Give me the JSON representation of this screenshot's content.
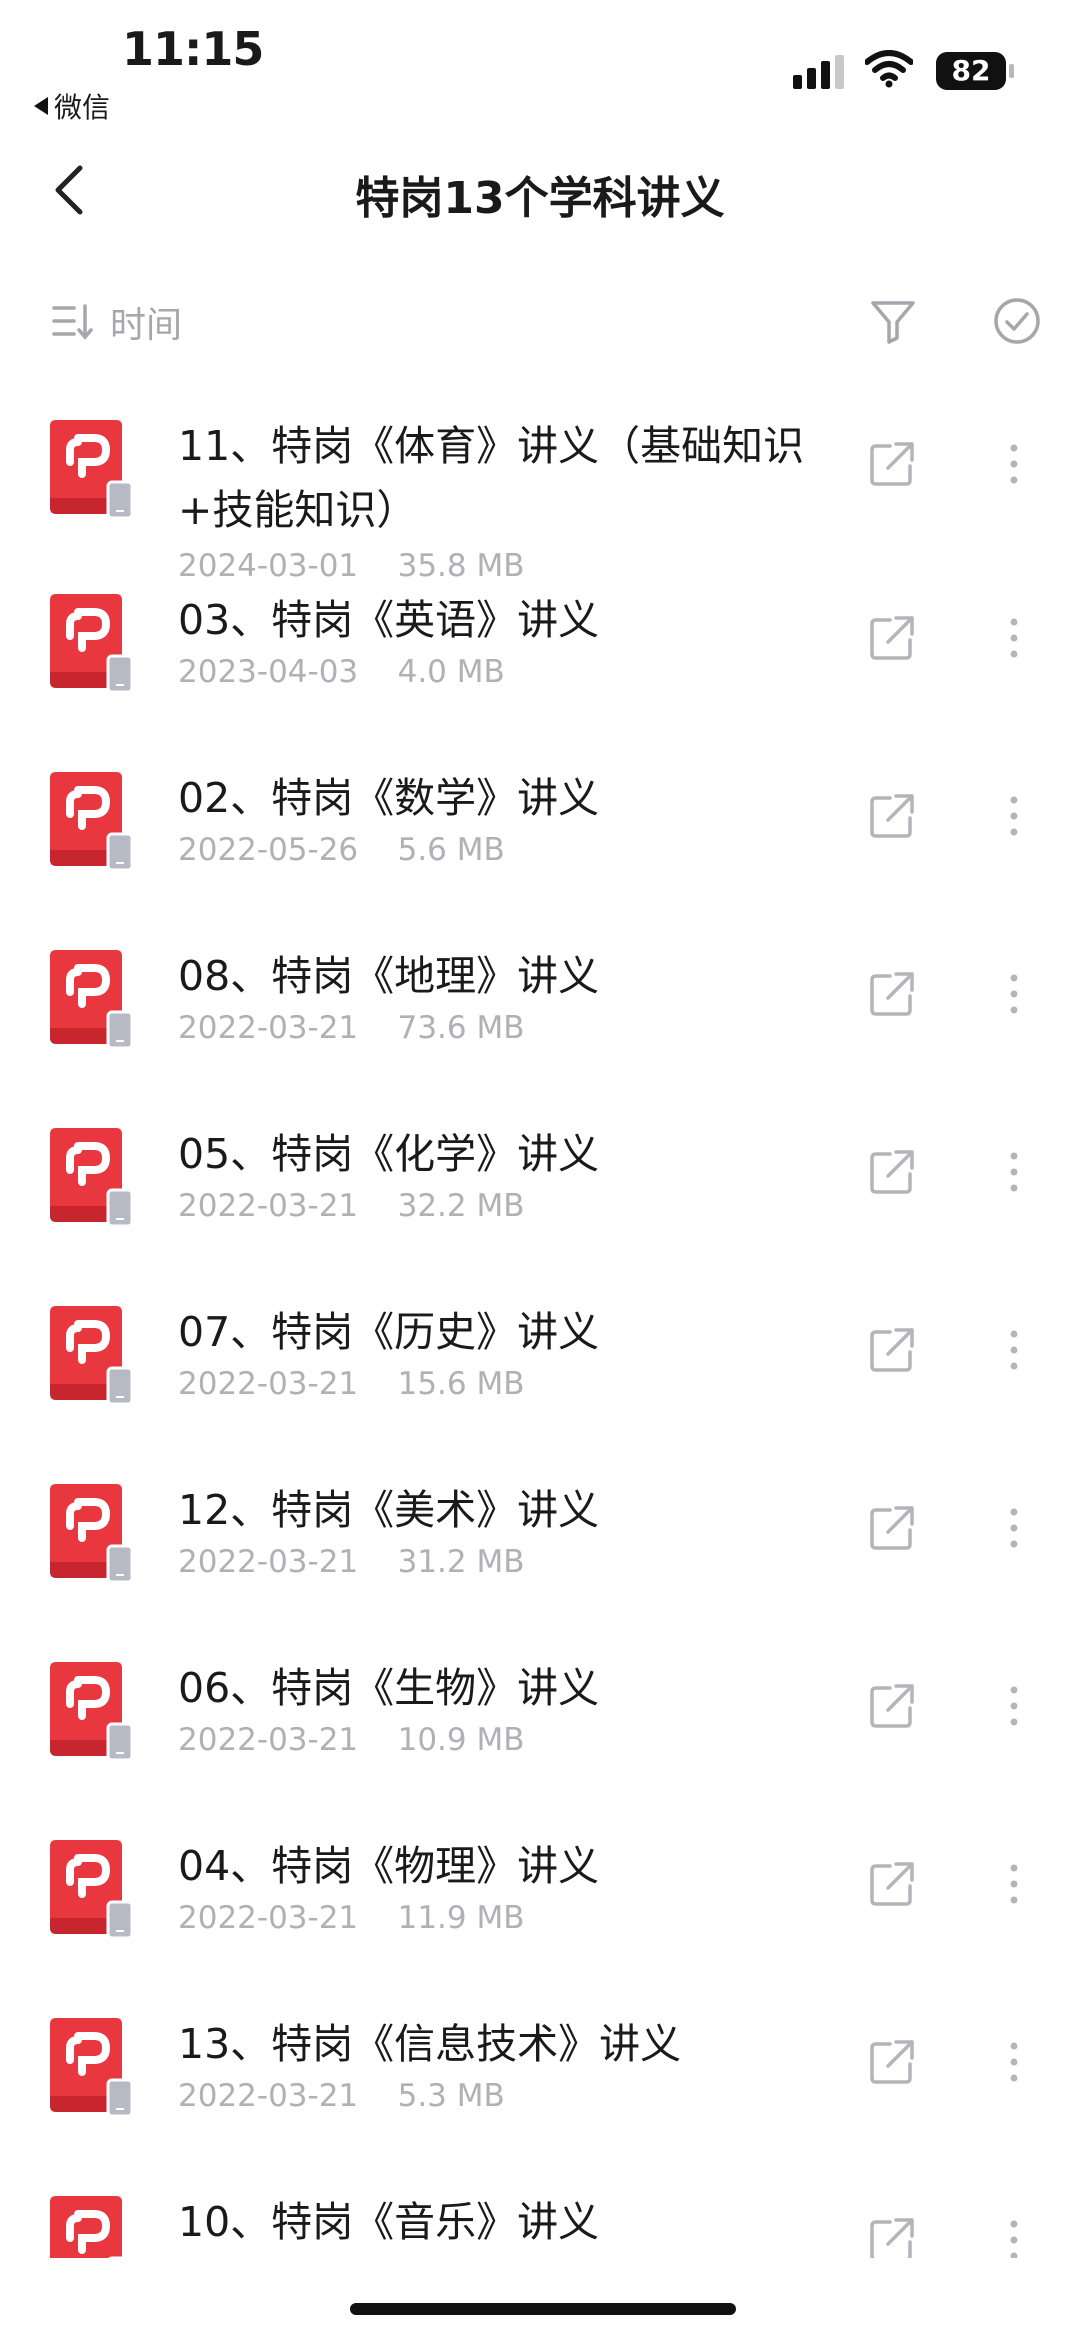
{
  "status_bar": {
    "time": "11:15",
    "back_app": "微信",
    "battery": "82",
    "icons": [
      "cellular-signal-icon",
      "wifi-icon",
      "battery-icon"
    ]
  },
  "nav": {
    "title": "特岗13个学科讲义",
    "back_icon": "chevron-left-icon"
  },
  "toolbar": {
    "sort_label": "时间",
    "sort_icon": "sort-lines-icon",
    "filter_icon": "filter-funnel-icon",
    "select_icon": "check-circle-icon"
  },
  "files": [
    {
      "name": "11、特岗《体育》讲义（基础知识+技能知识）",
      "date": "2024-03-01",
      "size": "35.8 MB"
    },
    {
      "name": "03、特岗《英语》讲义",
      "date": "2023-04-03",
      "size": "4.0 MB"
    },
    {
      "name": "02、特岗《数学》讲义",
      "date": "2022-05-26",
      "size": "5.6 MB"
    },
    {
      "name": "08、特岗《地理》讲义",
      "date": "2022-03-21",
      "size": "73.6 MB"
    },
    {
      "name": "05、特岗《化学》讲义",
      "date": "2022-03-21",
      "size": "32.2 MB"
    },
    {
      "name": "07、特岗《历史》讲义",
      "date": "2022-03-21",
      "size": "15.6 MB"
    },
    {
      "name": "12、特岗《美术》讲义",
      "date": "2022-03-21",
      "size": "31.2 MB"
    },
    {
      "name": "06、特岗《生物》讲义",
      "date": "2022-03-21",
      "size": "10.9 MB"
    },
    {
      "name": "04、特岗《物理》讲义",
      "date": "2022-03-21",
      "size": "11.9 MB"
    },
    {
      "name": "13、特岗《信息技术》讲义",
      "date": "2022-03-21",
      "size": "5.3 MB"
    },
    {
      "name": "10、特岗《音乐》讲义",
      "date": "",
      "size": ""
    }
  ],
  "row_icons": {
    "file": "pdf-file-icon",
    "share": "share-icon",
    "more": "more-vertical-icon"
  },
  "colors": {
    "pdf_red": "#e8373f",
    "muted": "#b0b0b6",
    "text": "#1a1a1a"
  }
}
